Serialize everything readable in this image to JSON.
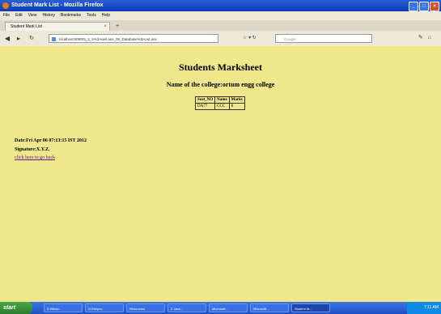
{
  "window": {
    "title": "Student Mark List - Mozilla Firefox"
  },
  "menu": [
    "File",
    "Edit",
    "View",
    "History",
    "Bookmarks",
    "Tools",
    "Help"
  ],
  "tab": {
    "label": "Student Mark List"
  },
  "address": {
    "url": "localhost:8080/5_3_5%3Awel.asn_09_Database%3Aout.asv",
    "search_placeholder": "Google"
  },
  "page": {
    "heading": "Students Marksheet",
    "college": "Name of the college:ortum engg college",
    "table": {
      "headers": [
        "Seat_NO",
        "Name",
        "Marks"
      ],
      "rows": [
        [
          "DA77",
          "CCC",
          "8"
        ]
      ]
    },
    "date_line": "Date:Fri Apr 06 07:13:15 IST 2012",
    "signature_line": "Signature:X.Y.Z.",
    "back_link": "click here to go back"
  },
  "taskbar": {
    "start_label": "start",
    "items": [
      "5 Windo...",
      "D:\\Hc\\pro...",
      "Resources",
      "2 Java...",
      "Microsoft...",
      "Microsoft...",
      "Student M..."
    ],
    "clock": "7:11 AM"
  }
}
